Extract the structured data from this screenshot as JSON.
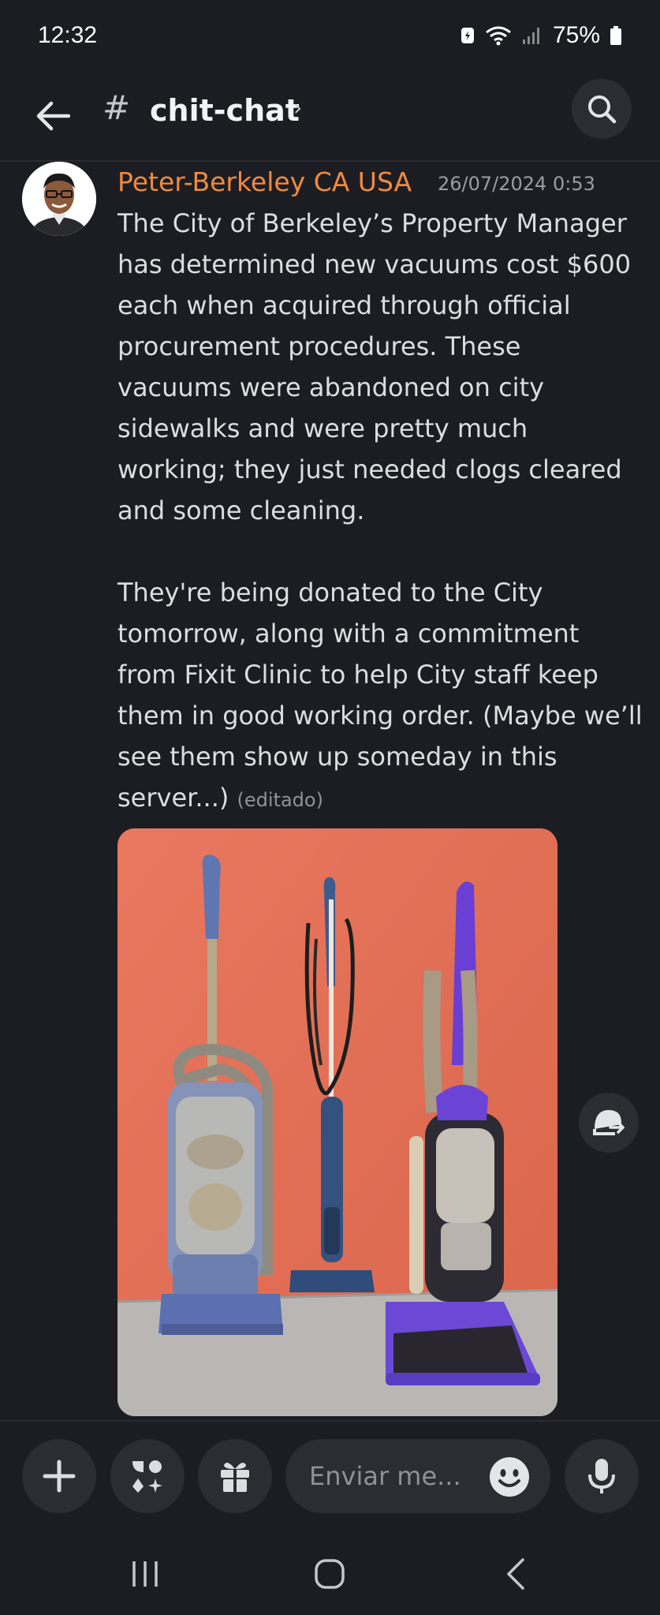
{
  "status": {
    "time": "12:32",
    "battery": "75%"
  },
  "header": {
    "channel_name": "chit-chat",
    "hash": "#",
    "chevron": "›"
  },
  "message": {
    "author": "Peter-Berkeley CA USA",
    "timestamp": "26/07/2024 0:53",
    "body": "The City of Berkeley’s Property Manager\nhas determined new vacuums cost $600\neach when acquired through official\nprocurement procedures. These\nvacuums were abandoned on city\nsidewalks and were pretty much\nworking; they just needed clogs cleared\nand some cleaning.\n\nThey're being donated to the City\ntomorrow, along with a commitment\nfrom Fixit Clinic to help City staff keep\nthem in good working order. (Maybe we’ll\nsee them show up someday in this\nserver...)",
    "edited_label": "(editado)"
  },
  "composer": {
    "placeholder": "Enviar me..."
  },
  "colors": {
    "background": "#1c1d22",
    "author": "#f08a3e",
    "button_bg": "#2b2d33",
    "photo_wall": "#e17157"
  },
  "icons": {
    "back": "arrow-left-icon",
    "search": "search-icon",
    "forward": "forward-icon",
    "plus": "plus-icon",
    "apps": "apps-icon",
    "gift": "gift-icon",
    "emoji": "emoji-icon",
    "mic": "microphone-icon"
  }
}
